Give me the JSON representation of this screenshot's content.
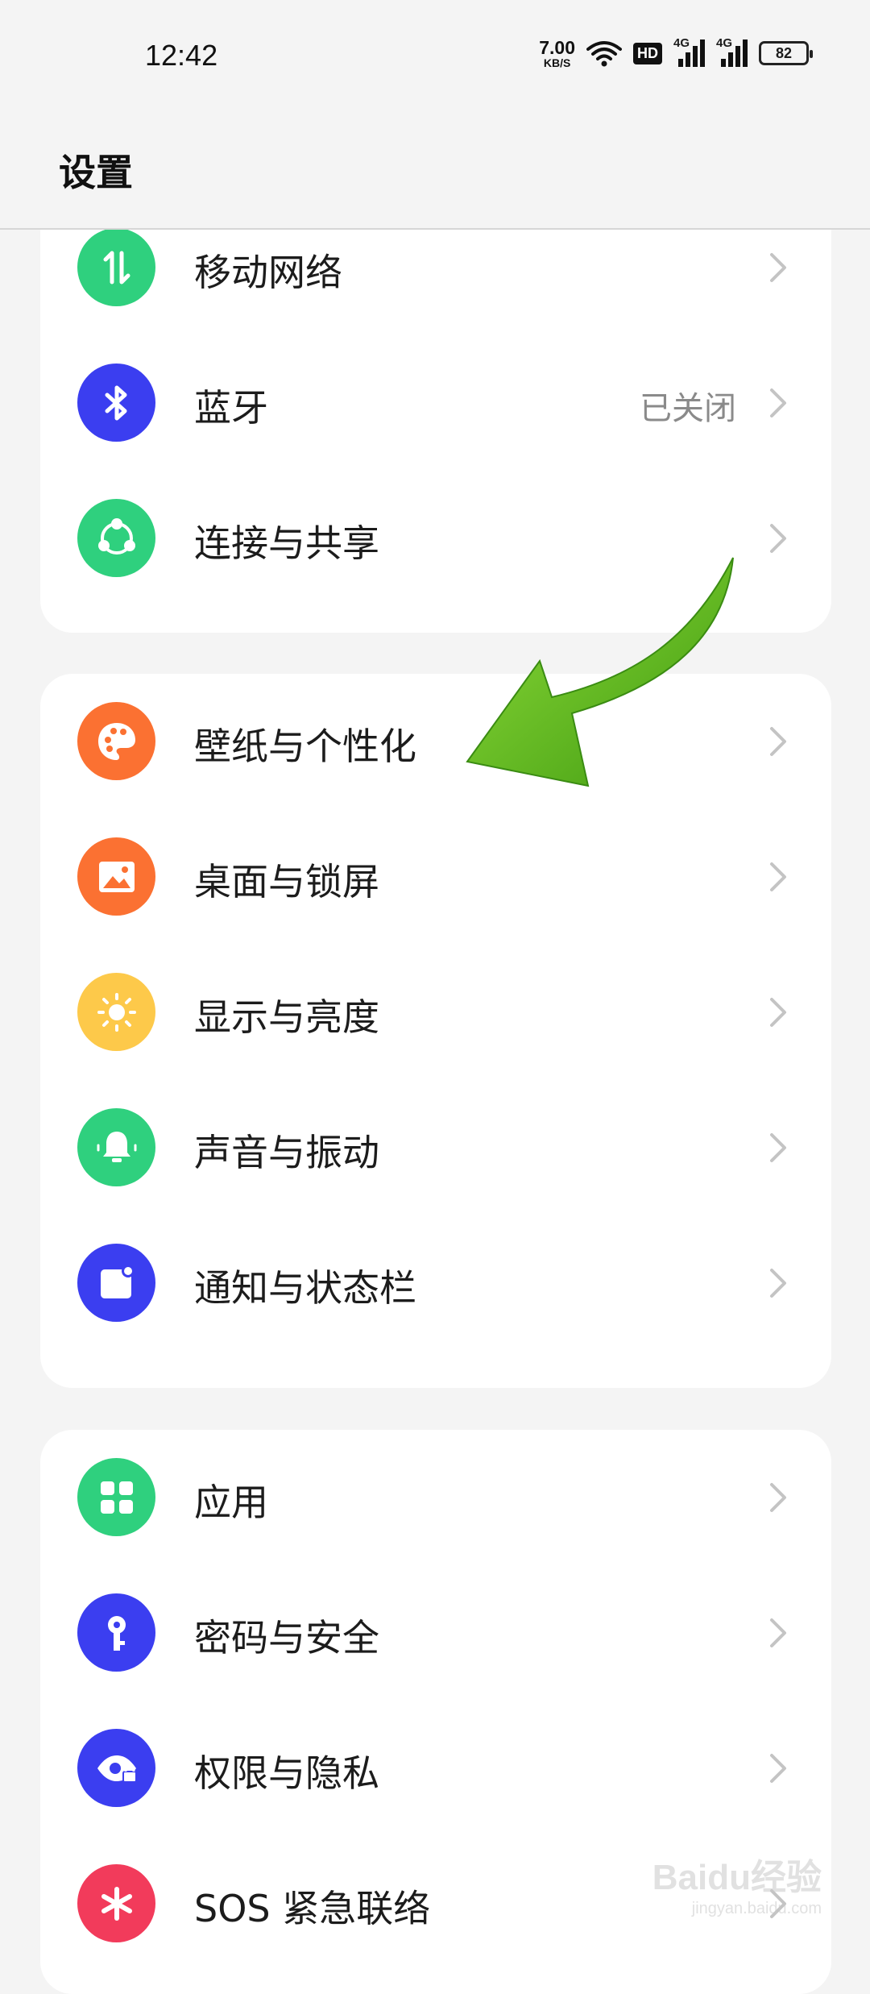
{
  "status_bar": {
    "time": "12:42",
    "net_speed_value": "7.00",
    "net_speed_unit": "KB/S",
    "hd_badge": "HD",
    "signal1_label": "4G",
    "signal2_label": "4G",
    "battery": "82",
    "icons": [
      "wifi-icon",
      "hd-voice-icon",
      "signal-icon",
      "signal-icon",
      "battery-icon"
    ]
  },
  "header": {
    "title": "设置"
  },
  "groups": [
    {
      "items": [
        {
          "label": "移动网络",
          "value": "",
          "icon": "mobile-data-icon",
          "color": "#2fd07e"
        },
        {
          "label": "蓝牙",
          "value": "已关闭",
          "icon": "bluetooth-icon",
          "color": "#3b3ef0"
        },
        {
          "label": "连接与共享",
          "value": "",
          "icon": "share-icon",
          "color": "#2fd07e"
        }
      ]
    },
    {
      "items": [
        {
          "label": "壁纸与个性化",
          "value": "",
          "icon": "palette-icon",
          "color": "#fb7132"
        },
        {
          "label": "桌面与锁屏",
          "value": "",
          "icon": "image-icon",
          "color": "#fb7132"
        },
        {
          "label": "显示与亮度",
          "value": "",
          "icon": "brightness-icon",
          "color": "#fdc94a"
        },
        {
          "label": "声音与振动",
          "value": "",
          "icon": "bell-icon",
          "color": "#2fd07e"
        },
        {
          "label": "通知与状态栏",
          "value": "",
          "icon": "notification-icon",
          "color": "#3b3ef0"
        }
      ]
    },
    {
      "items": [
        {
          "label": "应用",
          "value": "",
          "icon": "apps-icon",
          "color": "#2fd07e"
        },
        {
          "label": "密码与安全",
          "value": "",
          "icon": "key-icon",
          "color": "#3b3ef0"
        },
        {
          "label": "权限与隐私",
          "value": "",
          "icon": "privacy-eye-icon",
          "color": "#3b3ef0"
        },
        {
          "label": "SOS 紧急联络",
          "value": "",
          "icon": "sos-icon",
          "color": "#f23b5b"
        }
      ]
    }
  ],
  "watermark": {
    "logo": "Baidu经验",
    "url": "jingyan.baidu.com"
  },
  "colors": {
    "background": "#f4f4f4",
    "card": "#ffffff",
    "annotation_arrow": "#56b51b"
  }
}
